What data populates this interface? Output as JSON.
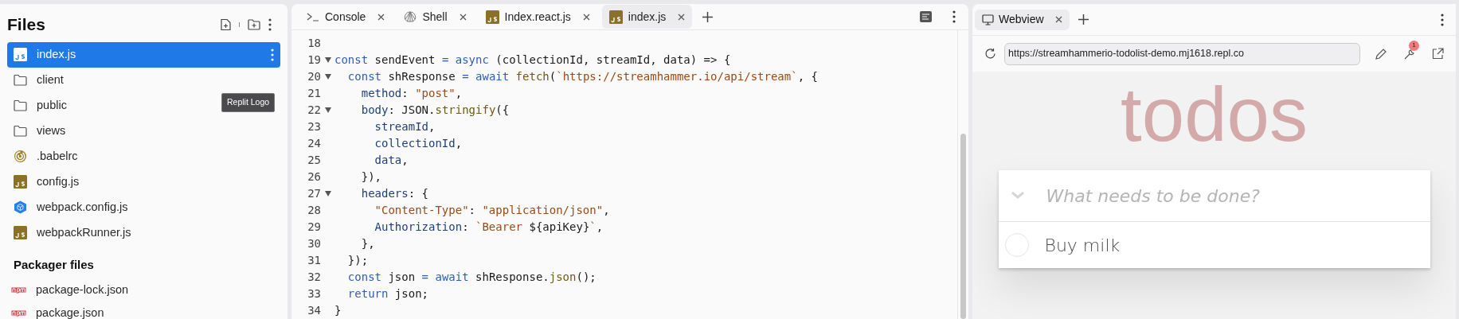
{
  "sidebar": {
    "title": "Files",
    "tooltip": "Replit Logo",
    "items": [
      {
        "name": "index.js",
        "kind": "js",
        "selected": true
      },
      {
        "name": "client",
        "kind": "folder",
        "selected": false
      },
      {
        "name": "public",
        "kind": "folder",
        "selected": false
      },
      {
        "name": "views",
        "kind": "folder",
        "selected": false
      },
      {
        "name": ".babelrc",
        "kind": "babel",
        "selected": false
      },
      {
        "name": "config.js",
        "kind": "js",
        "selected": false
      },
      {
        "name": "webpack.config.js",
        "kind": "webpack",
        "selected": false
      },
      {
        "name": "webpackRunner.js",
        "kind": "js",
        "selected": false
      }
    ],
    "section_title": "Packager files",
    "packager_items": [
      {
        "name": "package-lock.json",
        "kind": "npm"
      },
      {
        "name": "package.json",
        "kind": "npm"
      }
    ]
  },
  "editor": {
    "tabs": [
      {
        "label": "Console",
        "kind": "console",
        "selected": false
      },
      {
        "label": "Shell",
        "kind": "shell",
        "selected": false
      },
      {
        "label": "Index.react.js",
        "kind": "js",
        "selected": false
      },
      {
        "label": "index.js",
        "kind": "js",
        "selected": true
      }
    ],
    "lines": [
      {
        "number": "18",
        "foldable": false
      },
      {
        "number": "19",
        "foldable": true,
        "tokens": [
          {
            "text": "const",
            "kind": "keyword"
          },
          {
            "text": " sendEvent ",
            "kind": "plain"
          },
          {
            "text": "=",
            "kind": "keyword"
          },
          {
            "text": " async",
            "kind": "keyword"
          },
          {
            "text": " (collectionId, streamId, data) => {",
            "kind": "plain"
          }
        ]
      },
      {
        "number": "20",
        "foldable": true,
        "tokens": [
          {
            "text": "  const",
            "kind": "keyword"
          },
          {
            "text": " shResponse ",
            "kind": "plain"
          },
          {
            "text": "=",
            "kind": "keyword"
          },
          {
            "text": " await",
            "kind": "keyword"
          },
          {
            "text": " fetch",
            "kind": "function"
          },
          {
            "text": "(",
            "kind": "plain"
          },
          {
            "text": "`https://streamhammer.io/api/stream`",
            "kind": "string"
          },
          {
            "text": ", {",
            "kind": "plain"
          }
        ]
      },
      {
        "number": "21",
        "foldable": false,
        "tokens": [
          {
            "text": "    method",
            "kind": "property"
          },
          {
            "text": ": ",
            "kind": "plain"
          },
          {
            "text": "\"post\"",
            "kind": "string"
          },
          {
            "text": ",",
            "kind": "plain"
          }
        ]
      },
      {
        "number": "22",
        "foldable": true,
        "tokens": [
          {
            "text": "    body",
            "kind": "property"
          },
          {
            "text": ": JSON.",
            "kind": "plain"
          },
          {
            "text": "stringify",
            "kind": "function"
          },
          {
            "text": "({",
            "kind": "plain"
          }
        ]
      },
      {
        "number": "23",
        "foldable": false,
        "tokens": [
          {
            "text": "      streamId",
            "kind": "property"
          },
          {
            "text": ",",
            "kind": "plain"
          }
        ]
      },
      {
        "number": "24",
        "foldable": false,
        "tokens": [
          {
            "text": "      collectionId",
            "kind": "property"
          },
          {
            "text": ",",
            "kind": "plain"
          }
        ]
      },
      {
        "number": "25",
        "foldable": false,
        "tokens": [
          {
            "text": "      data",
            "kind": "property"
          },
          {
            "text": ",",
            "kind": "plain"
          }
        ]
      },
      {
        "number": "26",
        "foldable": false,
        "tokens": [
          {
            "text": "    }),",
            "kind": "plain"
          }
        ]
      },
      {
        "number": "27",
        "foldable": true,
        "tokens": [
          {
            "text": "    headers",
            "kind": "property"
          },
          {
            "text": ": {",
            "kind": "plain"
          }
        ]
      },
      {
        "number": "28",
        "foldable": false,
        "tokens": [
          {
            "text": "      \"Content-Type\"",
            "kind": "string"
          },
          {
            "text": ": ",
            "kind": "plain"
          },
          {
            "text": "\"application/json\"",
            "kind": "string"
          },
          {
            "text": ",",
            "kind": "plain"
          }
        ]
      },
      {
        "number": "29",
        "foldable": false,
        "tokens": [
          {
            "text": "      Authorization",
            "kind": "property"
          },
          {
            "text": ": ",
            "kind": "plain"
          },
          {
            "text": "`Bearer ",
            "kind": "string"
          },
          {
            "text": "${apiKey}",
            "kind": "plain"
          },
          {
            "text": "`",
            "kind": "string"
          },
          {
            "text": ",",
            "kind": "plain"
          }
        ]
      },
      {
        "number": "30",
        "foldable": false,
        "tokens": [
          {
            "text": "    },",
            "kind": "plain"
          }
        ]
      },
      {
        "number": "31",
        "foldable": false,
        "tokens": [
          {
            "text": "  });",
            "kind": "plain"
          }
        ]
      },
      {
        "number": "32",
        "foldable": false,
        "tokens": [
          {
            "text": "  const",
            "kind": "keyword"
          },
          {
            "text": " json ",
            "kind": "plain"
          },
          {
            "text": "=",
            "kind": "keyword"
          },
          {
            "text": " await",
            "kind": "keyword"
          },
          {
            "text": " shResponse.",
            "kind": "plain"
          },
          {
            "text": "json",
            "kind": "function"
          },
          {
            "text": "();",
            "kind": "plain"
          }
        ]
      },
      {
        "number": "33",
        "foldable": false,
        "tokens": [
          {
            "text": "  return",
            "kind": "keyword"
          },
          {
            "text": " json;",
            "kind": "plain"
          }
        ]
      },
      {
        "number": "34",
        "foldable": false,
        "tokens": [
          {
            "text": "}",
            "kind": "plain"
          }
        ]
      }
    ]
  },
  "webview": {
    "tab": {
      "label": "Webview",
      "selected": true
    },
    "url": "https://streamhammerio-todolist-demo.mj1618.repl.co",
    "badge": "1",
    "app": {
      "title": "todos",
      "placeholder": "What needs to be done?",
      "todos": [
        {
          "text": "Buy milk",
          "completed": false
        }
      ]
    }
  }
}
